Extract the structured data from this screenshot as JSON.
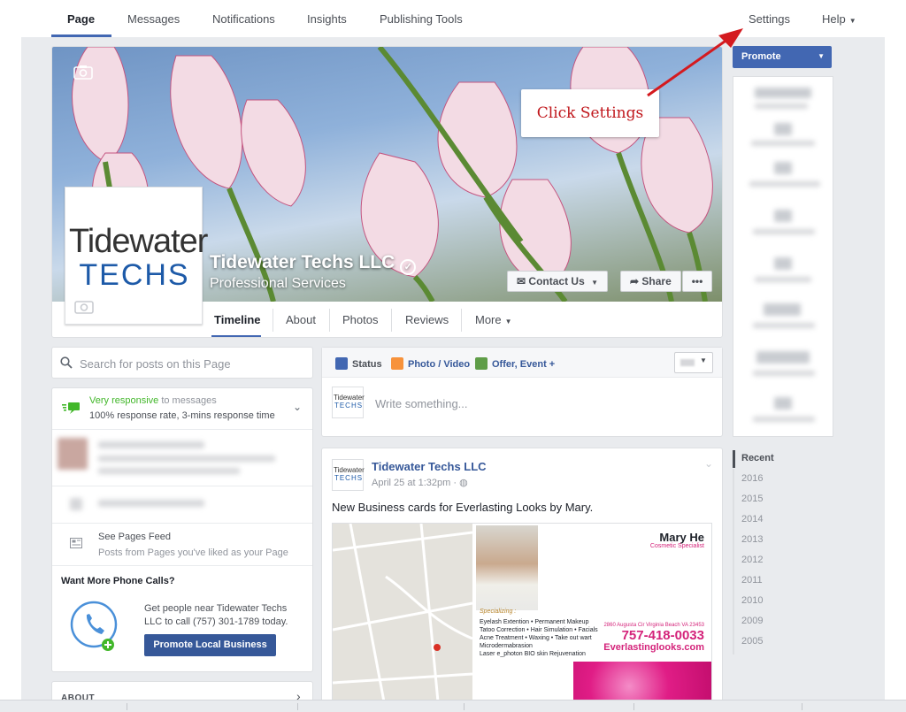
{
  "topnav": {
    "tabs": [
      "Page",
      "Messages",
      "Notifications",
      "Insights",
      "Publishing Tools"
    ],
    "settings": "Settings",
    "help": "Help"
  },
  "annotation": {
    "text": "Click Settings",
    "color": "#c0161b"
  },
  "page": {
    "name": "Tidewater Techs LLC",
    "category": "Professional Services",
    "logo_top": "Tidewater",
    "logo_bottom": "TECHS",
    "contact_button": "Contact Us",
    "share_button": "Share",
    "more_dots": "•••",
    "tabs": [
      "Timeline",
      "About",
      "Photos",
      "Reviews",
      "More"
    ]
  },
  "left": {
    "search_placeholder": "Search for posts on this Page",
    "responsive_label": "Very responsive",
    "responsive_suffix": "to messages",
    "response_rate": "100% response rate, 3-mins response time",
    "feed_title": "See Pages Feed",
    "feed_sub": "Posts from Pages you've liked as your Page",
    "phone_title": "Want More Phone Calls?",
    "phone_desc": "Get people near Tidewater Techs LLC to call (757) 301-1789 today.",
    "promote_local": "Promote Local Business",
    "about_label": "ABOUT"
  },
  "composer": {
    "tabs": [
      "Status",
      "Photo / Video",
      "Offer, Event +"
    ],
    "placeholder": "Write something..."
  },
  "post": {
    "author": "Tidewater Techs LLC",
    "time": "April 25 at 1:32pm",
    "text": "New Business cards for Everlasting Looks by Mary.",
    "card": {
      "name": "Mary He",
      "title": "Cosmetic Specialist",
      "specializing": "Specializing :",
      "services": [
        "Eyelash Extention • Permanent Makeup",
        "Tatoo Correction • Hair Simulation • Facials",
        "Acne Treatment • Waxing • Take out wart",
        "Microdermabrasion",
        "Laser e_photon BIO skin Rejuvenation"
      ],
      "address": "2860 Augusta Cir Virginia Beach VA 23453",
      "phone": "757-418-0033",
      "website": "Everlastinglooks.com"
    }
  },
  "right": {
    "promote": "Promote",
    "recent": "Recent",
    "years": [
      "2016",
      "2015",
      "2014",
      "2013",
      "2012",
      "2011",
      "2010",
      "2009",
      "2005"
    ]
  },
  "colors": {
    "fb_blue": "#4267b2",
    "link_blue": "#365899",
    "green": "#42b72a",
    "annotation_red": "#c0161b",
    "brand_pink": "#d4237a"
  }
}
